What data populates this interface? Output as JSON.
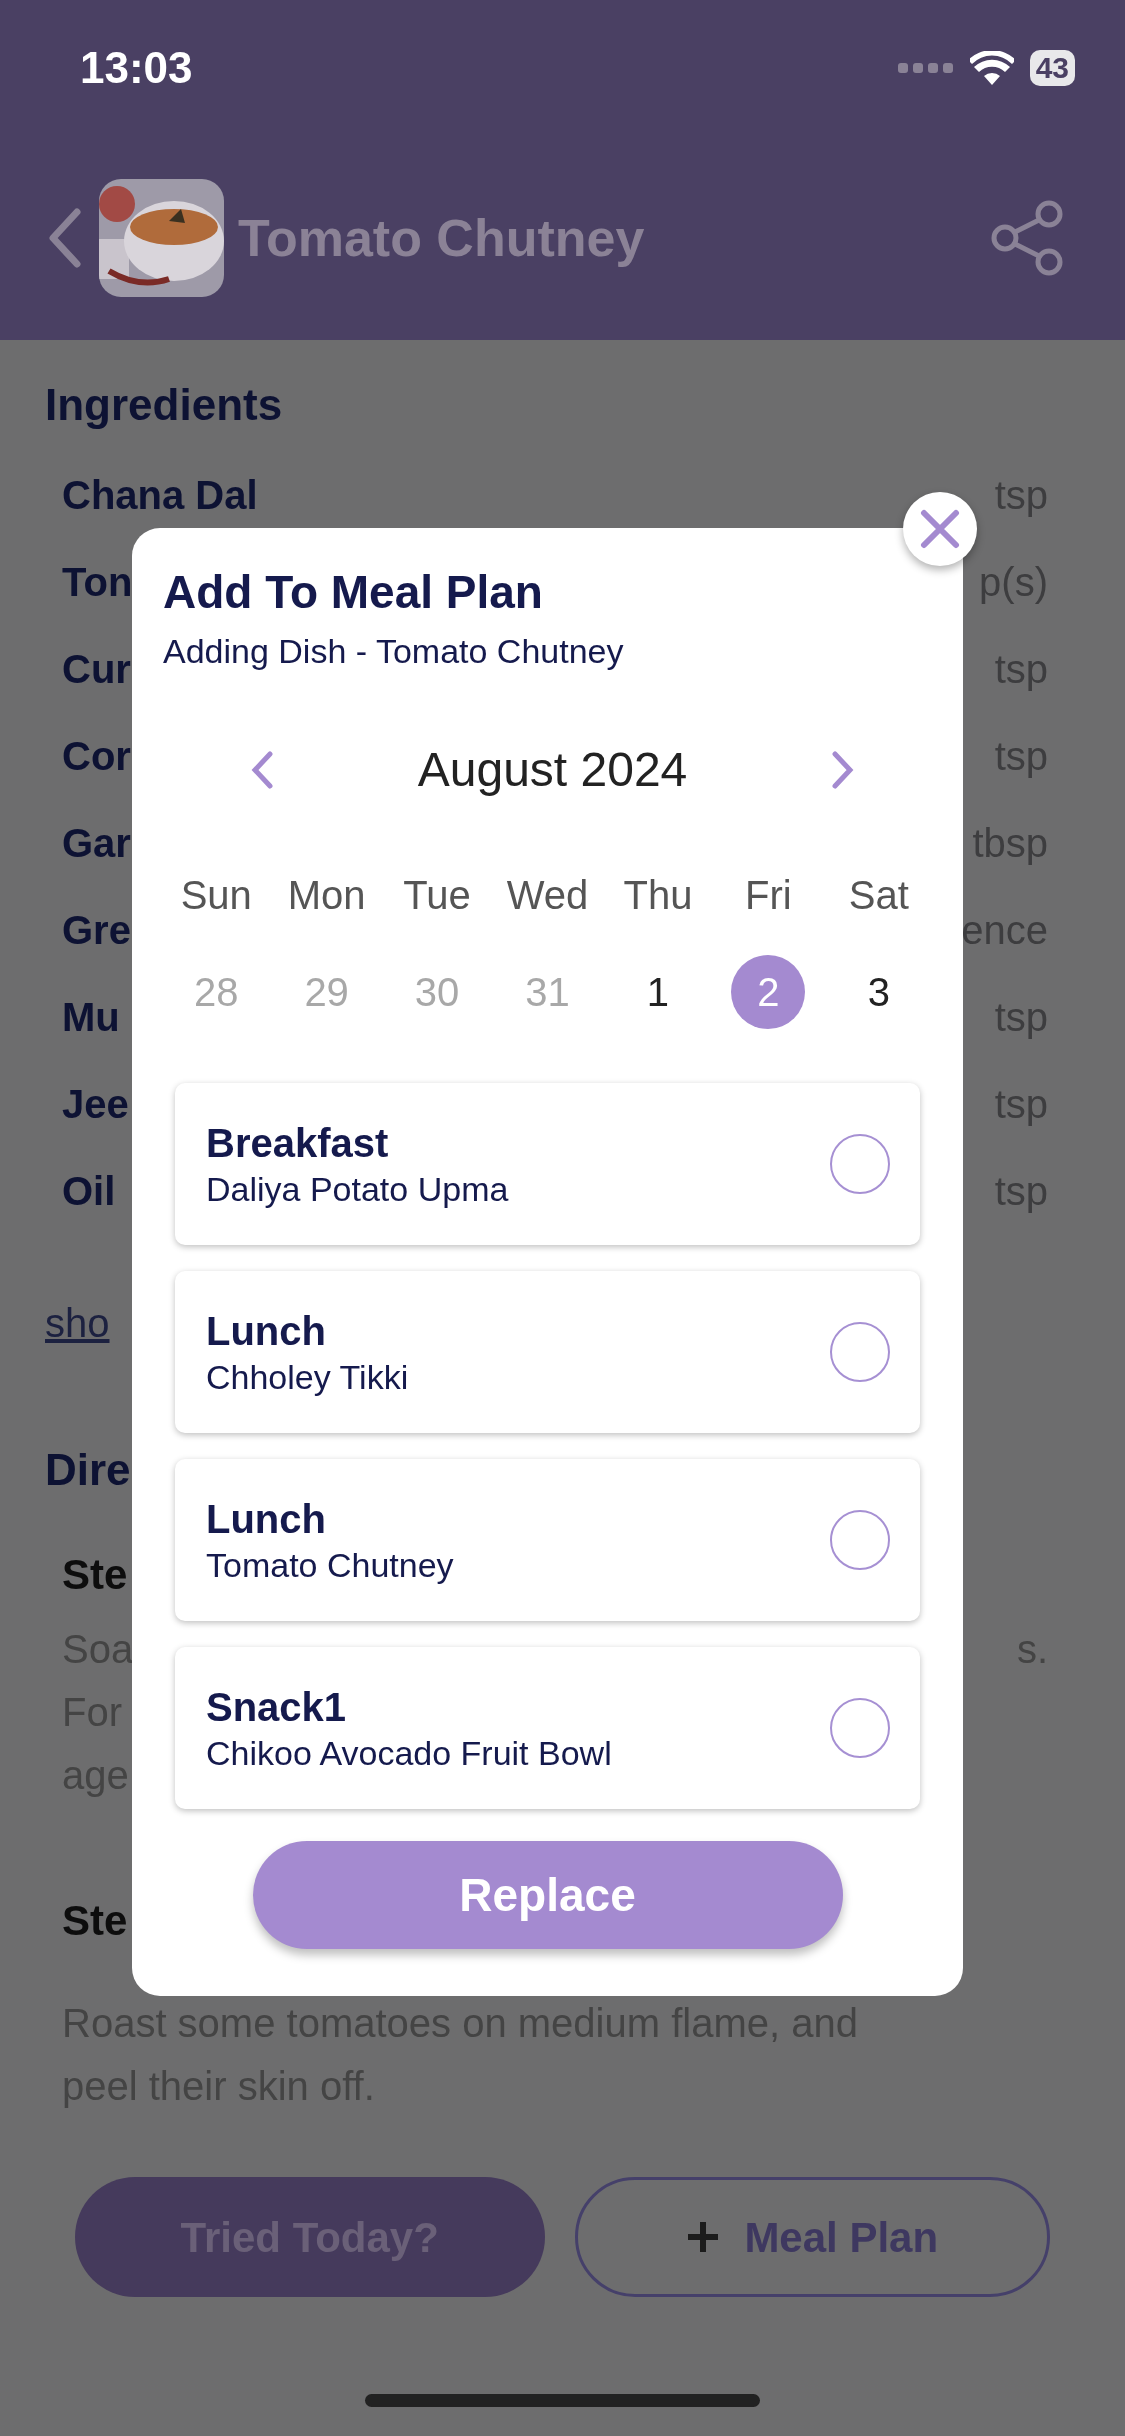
{
  "status_bar": {
    "time": "13:03",
    "battery": "43"
  },
  "header": {
    "title": "Tomato Chutney"
  },
  "ingredients": {
    "heading": "Ingredients",
    "items": [
      {
        "name": "Chana Dal",
        "amount": "tsp"
      },
      {
        "name": "Ton",
        "amount": "p(s)"
      },
      {
        "name": "Cur",
        "amount": "tsp"
      },
      {
        "name": "Cor",
        "amount": "tsp"
      },
      {
        "name": "Gar",
        "amount": "tbsp"
      },
      {
        "name": "Gre",
        "amount": "ence"
      },
      {
        "name": "Mu",
        "amount": "tsp"
      },
      {
        "name": "Jee",
        "amount": "tsp"
      },
      {
        "name": "Oil",
        "amount": "tsp"
      }
    ],
    "link": "sho"
  },
  "directions": {
    "heading": "Dire",
    "steps": [
      {
        "title": "Ste",
        "lines": [
          {
            "left": "Soa",
            "right": "s."
          },
          {
            "left": "For"
          },
          {
            "left": "age"
          }
        ]
      },
      {
        "title": "Ste",
        "lines": [
          {
            "left": "Roast some tomatoes on medium flame, and"
          },
          {
            "left": "peel their skin off."
          }
        ]
      }
    ]
  },
  "actions": [
    {
      "label": "Tried Today?",
      "kind": "filled"
    },
    {
      "label": "Meal Plan",
      "kind": "outline"
    }
  ],
  "modal": {
    "title": "Add To Meal Plan",
    "subtitle": "Adding Dish - Tomato Chutney",
    "month": "August 2024",
    "weekdays": [
      "Sun",
      "Mon",
      "Tue",
      "Wed",
      "Thu",
      "Fri",
      "Sat"
    ],
    "days": [
      {
        "label": "28",
        "muted": true,
        "selected": false
      },
      {
        "label": "29",
        "muted": true,
        "selected": false
      },
      {
        "label": "30",
        "muted": true,
        "selected": false
      },
      {
        "label": "31",
        "muted": true,
        "selected": false
      },
      {
        "label": "1",
        "muted": false,
        "selected": false
      },
      {
        "label": "2",
        "muted": false,
        "selected": true
      },
      {
        "label": "3",
        "muted": false,
        "selected": false
      }
    ],
    "meals": [
      {
        "meal": "Breakfast",
        "dish": "Daliya Potato Upma",
        "selected": false
      },
      {
        "meal": "Lunch",
        "dish": "Chholey Tikki",
        "selected": false
      },
      {
        "meal": "Lunch",
        "dish": "Tomato Chutney",
        "selected": false
      },
      {
        "meal": "Snack1",
        "dish": "Chikoo Avocado Fruit Bowl",
        "selected": false
      }
    ],
    "button": "Replace"
  }
}
